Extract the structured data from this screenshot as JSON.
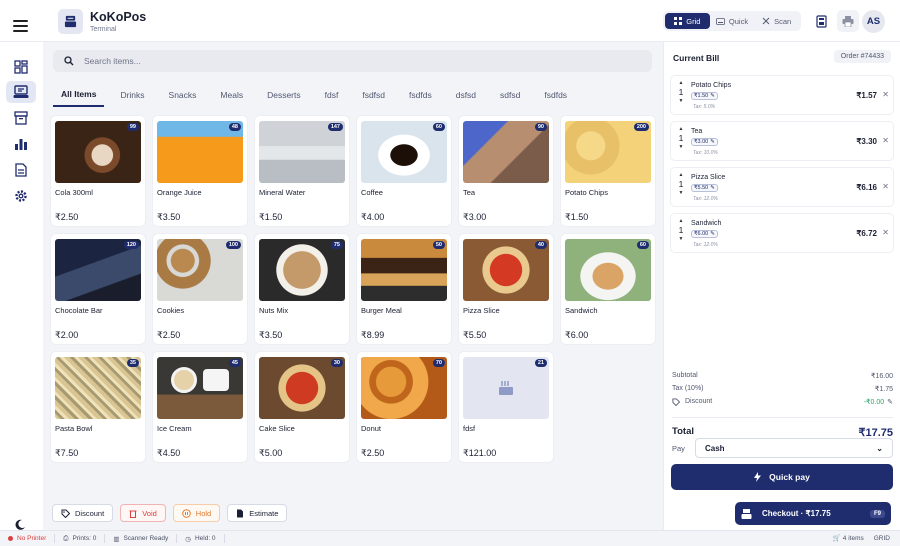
{
  "header": {
    "brand_title": "KoKoPos",
    "brand_subtitle": "Terminal",
    "modes": [
      "Grid",
      "Quick",
      "Scan"
    ],
    "active_mode": "Grid",
    "avatar_initials": "AS"
  },
  "search": {
    "placeholder": "Search items..."
  },
  "tabs": [
    "All Items",
    "Drinks",
    "Snacks",
    "Meals",
    "Desserts",
    "fdsf",
    "fsdfsd",
    "fsdfds",
    "dsfsd",
    "sdfsd",
    "fsdfds"
  ],
  "products": [
    {
      "name": "Cola 300ml",
      "price": "₹2.50",
      "stock": "99",
      "image": "coffee-latte-photo"
    },
    {
      "name": "Orange Juice",
      "price": "₹3.50",
      "stock": "48",
      "image": "orange-juice-photo"
    },
    {
      "name": "Mineral Water",
      "price": "₹1.50",
      "stock": "147",
      "image": "water-bottle-photo"
    },
    {
      "name": "Coffee",
      "price": "₹4.00",
      "stock": "60",
      "image": "coffee-cup-photo"
    },
    {
      "name": "Tea",
      "price": "₹3.00",
      "stock": "90",
      "image": "tea-glass-photo"
    },
    {
      "name": "Potato Chips",
      "price": "₹1.50",
      "stock": "200",
      "image": "potato-chips-photo"
    },
    {
      "name": "Chocolate Bar",
      "price": "₹2.00",
      "stock": "120",
      "image": "night-sky-photo"
    },
    {
      "name": "Cookies",
      "price": "₹2.50",
      "stock": "100",
      "image": "cookies-photo"
    },
    {
      "name": "Nuts Mix",
      "price": "₹3.50",
      "stock": "75",
      "image": "nuts-mix-photo"
    },
    {
      "name": "Burger Meal",
      "price": "₹8.99",
      "stock": "50",
      "image": "burger-photo"
    },
    {
      "name": "Pizza Slice",
      "price": "₹5.50",
      "stock": "40",
      "image": "pizza-photo"
    },
    {
      "name": "Sandwich",
      "price": "₹6.00",
      "stock": "60",
      "image": "sandwich-photo"
    },
    {
      "name": "Pasta Bowl",
      "price": "₹7.50",
      "stock": "35",
      "image": "pasta-photo"
    },
    {
      "name": "Ice Cream",
      "price": "₹4.50",
      "stock": "45",
      "image": "ice-cream-photo"
    },
    {
      "name": "Cake Slice",
      "price": "₹5.00",
      "stock": "30",
      "image": "pizza-photo-2"
    },
    {
      "name": "Donut",
      "price": "₹2.50",
      "stock": "70",
      "image": "donut-photo"
    },
    {
      "name": "fdsf",
      "price": "₹121.00",
      "stock": "21",
      "image": "placeholder-food-icon"
    }
  ],
  "toolbar": {
    "discount": "Discount",
    "void": "Void",
    "hold": "Hold",
    "estimate": "Estimate"
  },
  "bill": {
    "title": "Current Bill",
    "order_no": "Order #74433",
    "items": [
      {
        "name": "Potato Chips",
        "qty": "1",
        "unit": "₹1.50",
        "tax": "Tax: 5.0%",
        "total": "₹1.57"
      },
      {
        "name": "Tea",
        "qty": "1",
        "unit": "₹3.00",
        "tax": "Tax: 10.0%",
        "total": "₹3.30"
      },
      {
        "name": "Pizza Slice",
        "qty": "1",
        "unit": "₹5.50",
        "tax": "Tax: 12.0%",
        "total": "₹6.16"
      },
      {
        "name": "Sandwich",
        "qty": "1",
        "unit": "₹6.00",
        "tax": "Tax: 12.0%",
        "total": "₹6.72"
      }
    ],
    "subtotal_label": "Subtotal",
    "subtotal": "₹16.00",
    "tax_label": "Tax (10%)",
    "tax": "₹1.75",
    "discount_label": "Discount",
    "discount": "-₹0.00",
    "total_label": "Total",
    "total": "₹17.75",
    "pay_label": "Pay",
    "pay_method": "Cash",
    "quick_pay": "Quick pay",
    "checkout": "Checkout · ₹17.75",
    "checkout_key": "F9"
  },
  "status": {
    "printer": "No Printer",
    "prints": "Prints: 0",
    "scanner": "Scanner Ready",
    "held": "Held: 0",
    "items_count": "4 items",
    "view_mode": "GRID"
  },
  "colors": {
    "accent": "#1f2d6e",
    "void": "#d8413f",
    "hold": "#e07b2c",
    "discount": "#2ea56b"
  }
}
